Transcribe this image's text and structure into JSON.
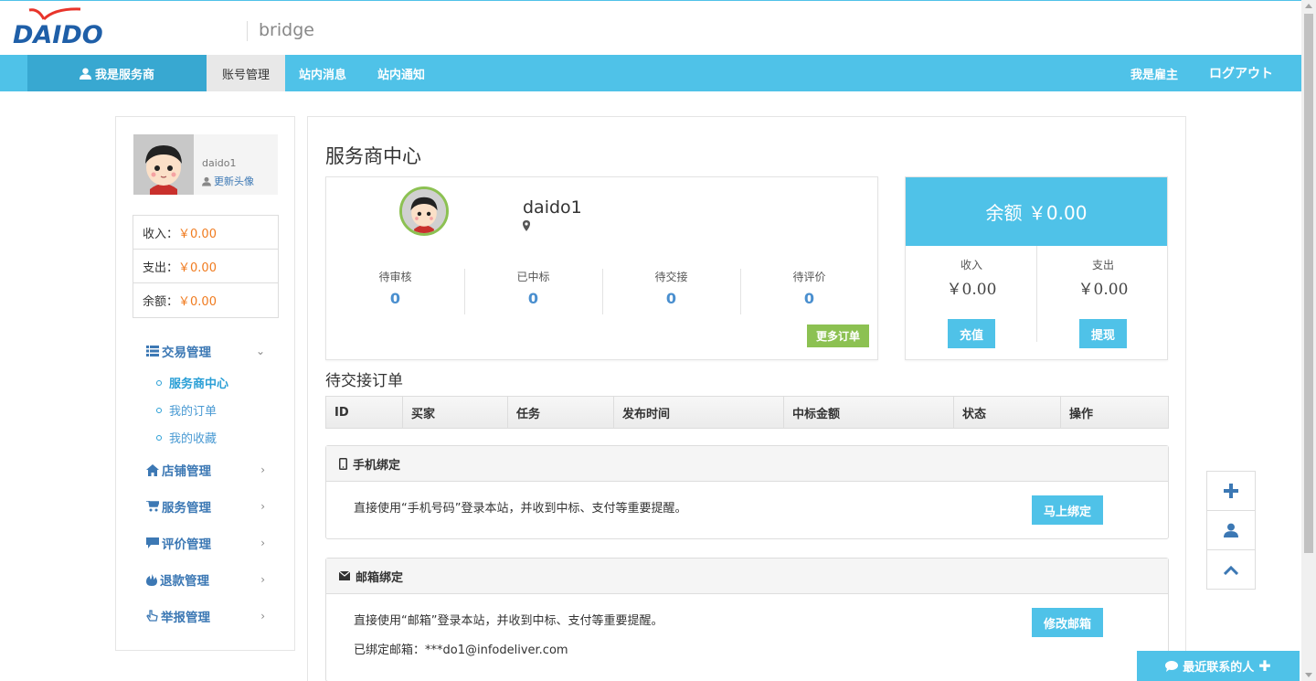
{
  "header": {
    "logo_text": "DAIDO",
    "subtitle": "bridge"
  },
  "nav": {
    "role_label": "我是服务商",
    "items": [
      {
        "label": "账号管理"
      },
      {
        "label": "站内消息"
      },
      {
        "label": "站内通知"
      }
    ],
    "right_items": [
      {
        "label": "我是雇主"
      },
      {
        "label": "ログアウト"
      }
    ]
  },
  "sidebar": {
    "username": "daido1",
    "update_avatar": "更新头像",
    "balances": [
      {
        "label": "收入：",
        "value": "￥0.00"
      },
      {
        "label": "支出：",
        "value": "￥0.00"
      },
      {
        "label": "余额：",
        "value": "￥0.00"
      }
    ],
    "menu": {
      "trade": "交易管理",
      "trade_items": [
        "服务商中心",
        "我的订单",
        "我的收藏"
      ],
      "shop": "店铺管理",
      "service": "服务管理",
      "review": "评价管理",
      "refund": "退款管理",
      "report": "举报管理"
    }
  },
  "main": {
    "title": "服务商中心",
    "username": "daido1",
    "stats": [
      {
        "label": "待审核",
        "value": "0"
      },
      {
        "label": "已中标",
        "value": "0"
      },
      {
        "label": "待交接",
        "value": "0"
      },
      {
        "label": "待评价",
        "value": "0"
      }
    ],
    "more_orders": "更多订单",
    "balance_title": "余额 ￥0.00",
    "income_label": "收入",
    "income_value": "￥0.00",
    "expense_label": "支出",
    "expense_value": "￥0.00",
    "recharge": "充值",
    "withdraw": "提现",
    "orders_title": "待交接订单",
    "table_headers": [
      "ID",
      "买家",
      "任务",
      "发布时间",
      "中标金额",
      "状态",
      "操作"
    ],
    "phone_bind": {
      "title": "手机绑定",
      "text": "直接使用“手机号码”登录本站，并收到中标、支付等重要提醒。",
      "button": "马上绑定"
    },
    "email_bind": {
      "title": "邮箱绑定",
      "text": "直接使用“邮箱”登录本站，并收到中标、支付等重要提醒。",
      "bound": "已绑定邮箱：***do1@infodeliver.com",
      "button": "修改邮箱"
    }
  },
  "contacts_bar": "最近联系的人",
  "colors": {
    "accent": "#4fc2e8",
    "accent_dark": "#38a8d1",
    "green": "#8cc152",
    "orange": "#f07b1f",
    "link": "#3c78b4"
  }
}
